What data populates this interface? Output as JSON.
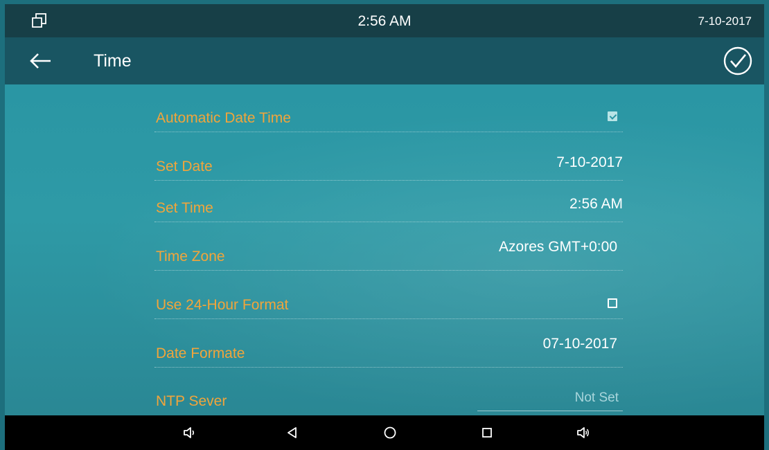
{
  "status_bar": {
    "time": "2:56 AM",
    "date": "7-10-2017",
    "window_icon": "window-restore-icon"
  },
  "title_bar": {
    "back_icon": "arrow-left-icon",
    "title": "Time",
    "confirm_icon": "check-circle-icon"
  },
  "settings": {
    "automatic_date_time": {
      "label": "Automatic Date Time",
      "checked": true
    },
    "set_date": {
      "label": "Set Date",
      "value": "7-10-2017"
    },
    "set_time": {
      "label": "Set Time",
      "value": "2:56 AM"
    },
    "time_zone": {
      "label": "Time Zone",
      "value": "Azores GMT+0:00"
    },
    "use_24_hour": {
      "label": "Use 24-Hour Format",
      "checked": false
    },
    "date_format": {
      "label": "Date Formate",
      "value": "07-10-2017"
    },
    "ntp_server": {
      "label": "NTP Sever",
      "placeholder": "Not Set"
    }
  },
  "nav_bar": {
    "icons": [
      "volume-down-icon",
      "back-triangle-icon",
      "home-circle-icon",
      "recents-square-icon",
      "volume-up-icon"
    ]
  },
  "colors": {
    "accent_label": "#f1a53b",
    "status_bar": "#173f47",
    "title_bar": "#195562",
    "content_bg": "#2a96a4"
  }
}
